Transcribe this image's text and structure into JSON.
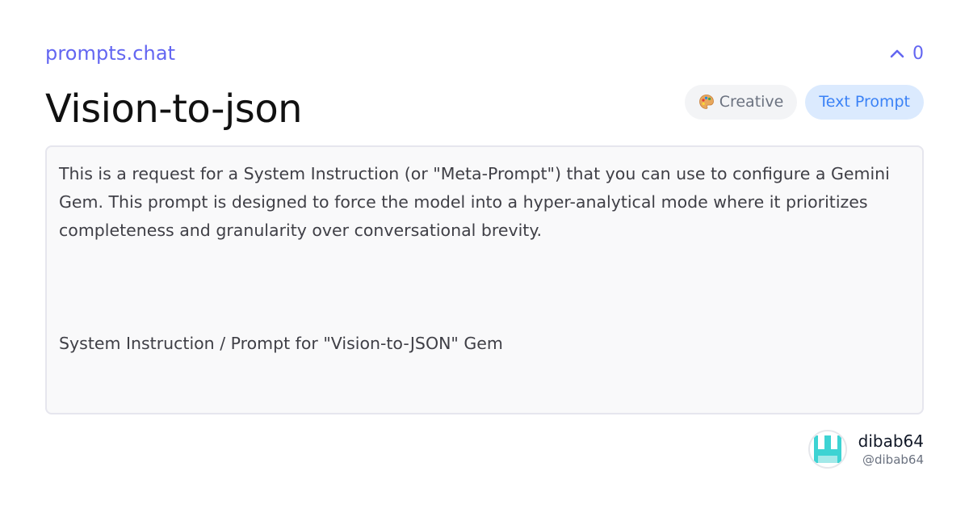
{
  "header": {
    "site_name": "prompts.chat",
    "vote_count": "0"
  },
  "prompt": {
    "title": "Vision-to-json",
    "tags": {
      "category_label": "Creative",
      "category_icon": "palette-icon",
      "type_label": "Text Prompt"
    },
    "body": {
      "paragraph_1": "This is a request for a System Instruction (or \"Meta-Prompt\") that you can use to configure a Gemini Gem. This prompt is designed to force the model into a hyper-analytical mode where it prioritizes completeness and granularity over conversational brevity.",
      "paragraph_2": "System Instruction / Prompt for \"Vision-to-JSON\" Gem"
    }
  },
  "author": {
    "name": "dibab64",
    "handle": "@dibab64",
    "avatar_icon": "avatar-identicon"
  },
  "colors": {
    "accent": "#6366f1",
    "type_tag_bg": "#dbeafe",
    "type_tag_text": "#3b82f6",
    "category_tag_bg": "#f3f4f6",
    "avatar_color": "#3dd3d3"
  }
}
